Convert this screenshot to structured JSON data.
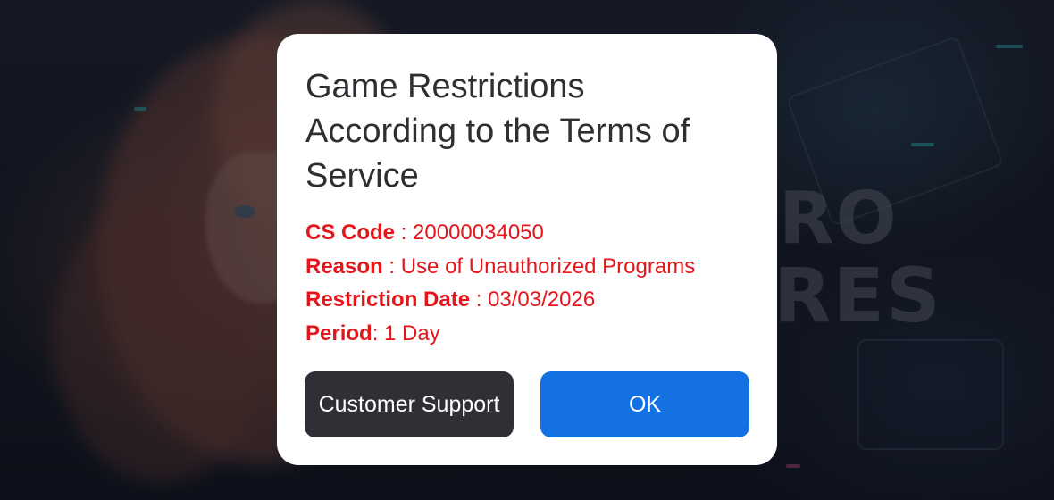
{
  "background": {
    "logo_line_1": "RO",
    "logo_line_2": "RES"
  },
  "dialog": {
    "title": "Game Restrictions According to the Terms of Service",
    "details": [
      {
        "label": "CS Code",
        "separator": " : ",
        "value": "20000034050"
      },
      {
        "label": "Reason",
        "separator": " : ",
        "value": "Use of Unauthorized Programs"
      },
      {
        "label": "Restriction Date",
        "separator": " : ",
        "value": "03/03/2026"
      },
      {
        "label": "Period",
        "separator": ": ",
        "value": "1 Day"
      }
    ],
    "buttons": {
      "support_label": "Customer Support",
      "ok_label": "OK"
    }
  },
  "colors": {
    "dialog_background": "#ffffff",
    "title_text": "#2d2f33",
    "detail_text": "#e3161b",
    "support_button": "#2e3035",
    "ok_button": "#1371e2",
    "button_text": "#ffffff"
  }
}
